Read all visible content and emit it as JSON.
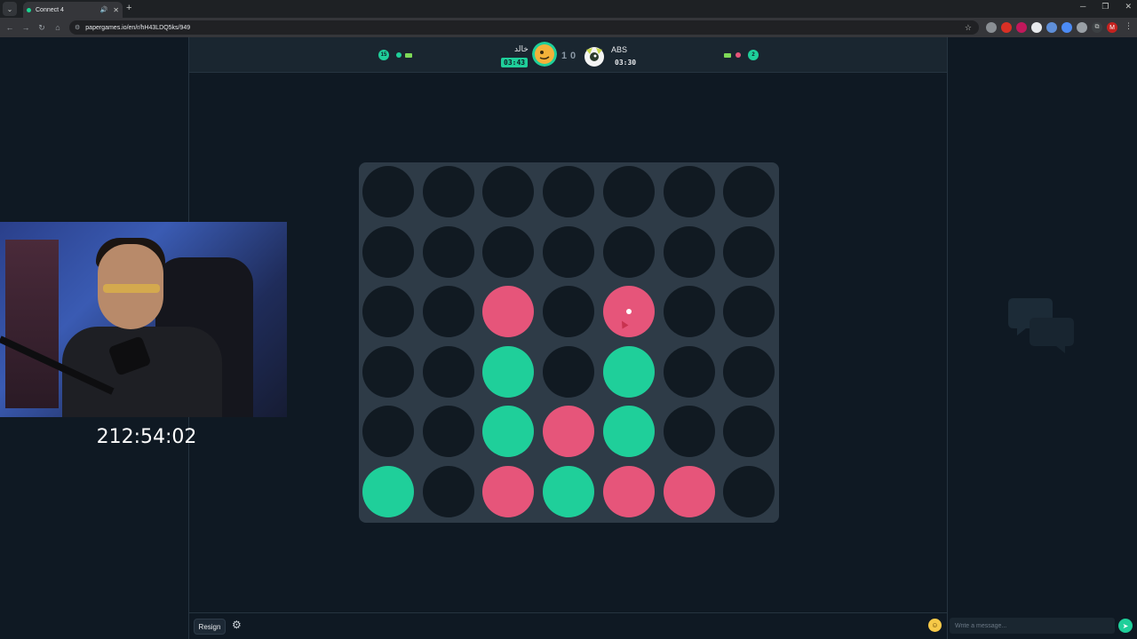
{
  "browser": {
    "tab_title": "Connect 4",
    "url": "papergames.io/en/r/hH43LDQ5ks/949"
  },
  "header": {
    "left_player": {
      "wins_badge": "15",
      "name": "خالد",
      "timer": "03:43",
      "score": "1",
      "piece_color": "#1fcf9a"
    },
    "right_player": {
      "wins_badge": "2",
      "name": "ABS",
      "timer": "03:30",
      "score": "0",
      "piece_color": "#e6557a"
    }
  },
  "board": {
    "rows": 6,
    "cols": 7,
    "grid": [
      [
        "empty",
        "empty",
        "empty",
        "empty",
        "empty",
        "empty",
        "empty"
      ],
      [
        "empty",
        "empty",
        "empty",
        "empty",
        "empty",
        "empty",
        "empty"
      ],
      [
        "empty",
        "empty",
        "red",
        "empty",
        "red",
        "empty",
        "empty"
      ],
      [
        "empty",
        "empty",
        "green",
        "empty",
        "green",
        "empty",
        "empty"
      ],
      [
        "empty",
        "empty",
        "green",
        "red",
        "green",
        "empty",
        "empty"
      ],
      [
        "green",
        "empty",
        "red",
        "green",
        "red",
        "red",
        "empty"
      ]
    ],
    "last_move": {
      "row": 2,
      "col": 4
    },
    "colors": {
      "empty": "#111a22",
      "red": "#e6557a",
      "green": "#1fcf9a"
    }
  },
  "footer": {
    "resign_label": "Resign"
  },
  "stream": {
    "elapsed_timer": "212:54:02"
  },
  "chat": {
    "input_placeholder": "Write a message..."
  }
}
